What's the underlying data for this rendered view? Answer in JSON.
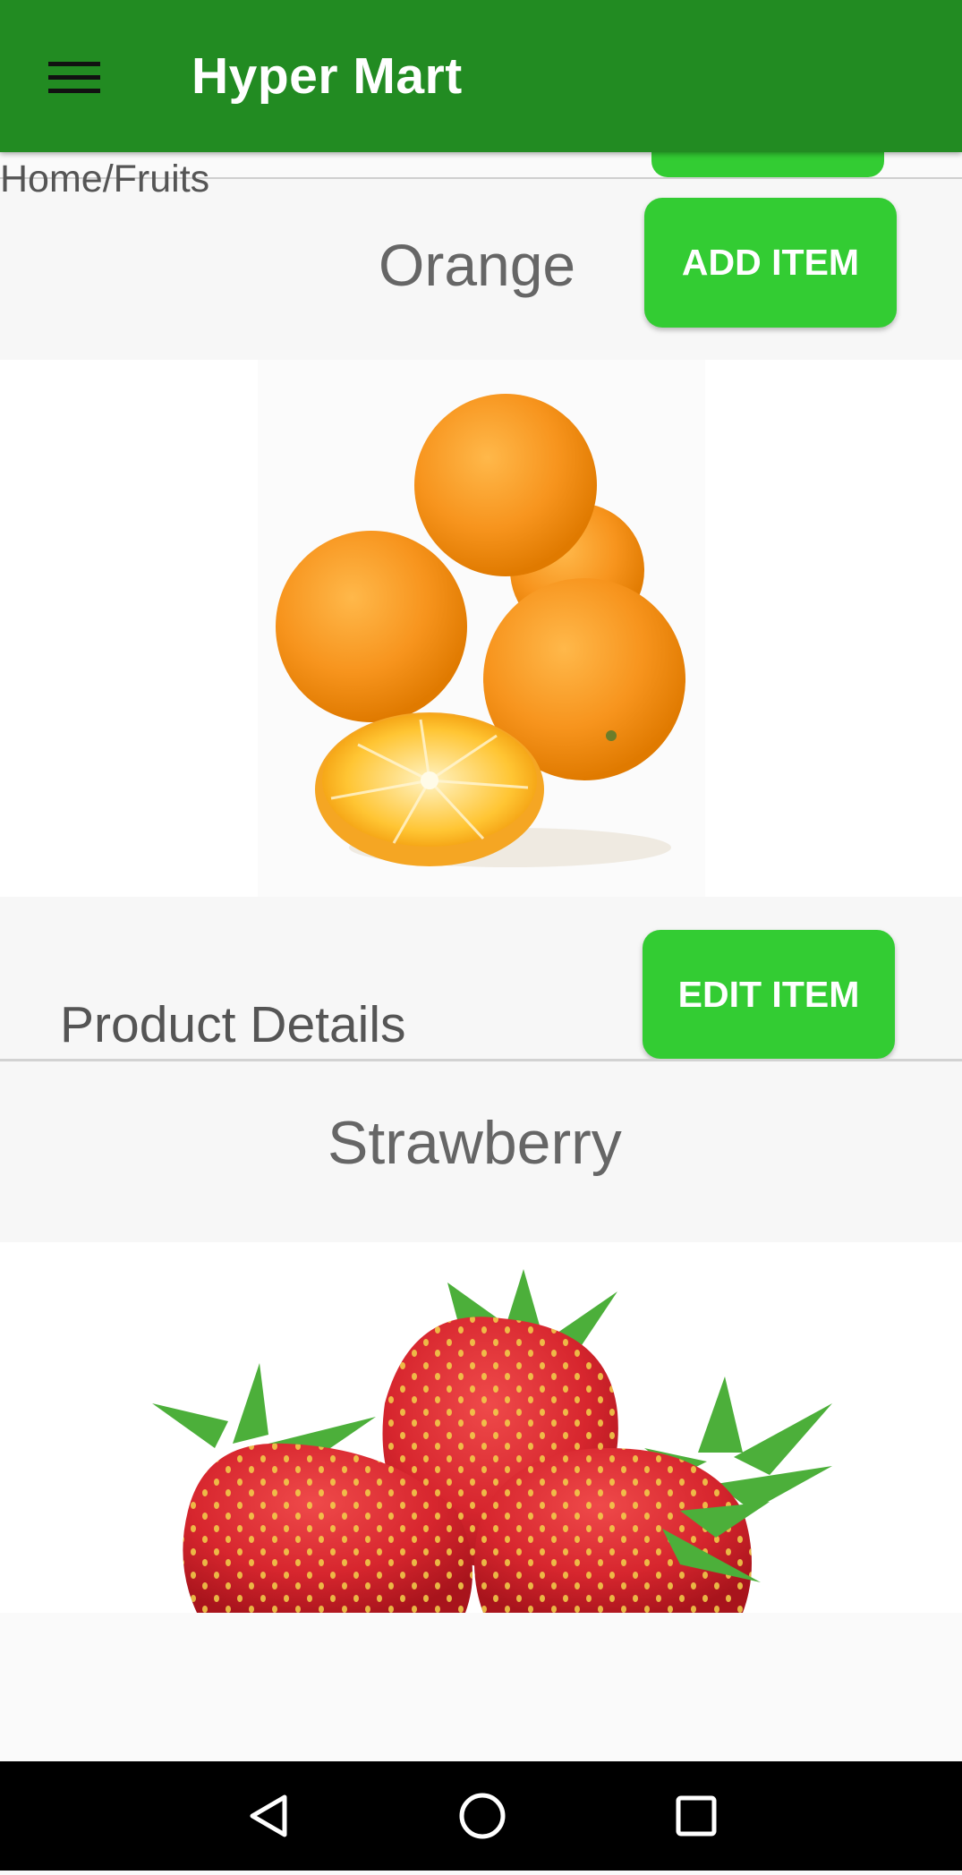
{
  "app": {
    "title": "Hyper Mart",
    "accent": "#228b22",
    "button_color": "#33cc33"
  },
  "icons": {
    "menu": "menu-icon",
    "back": "back-triangle-icon",
    "home": "home-circle-icon",
    "recent": "recent-apps-square-icon"
  },
  "breadcrumb": "Home/Fruits",
  "products": [
    {
      "name": "Orange",
      "action_label": "ADD ITEM",
      "image": "orange-image",
      "details_label": "Product Details",
      "secondary_action_label": "EDIT ITEM"
    },
    {
      "name": "Strawberry",
      "image": "strawberry-image"
    }
  ]
}
